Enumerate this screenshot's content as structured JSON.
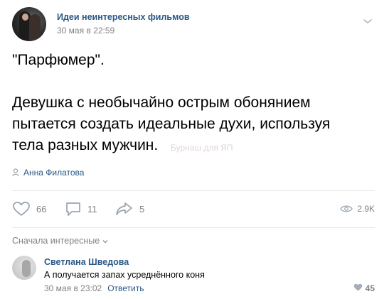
{
  "post": {
    "group_name": "Идеи неинтересных фильмов",
    "date": "30 мая в 22:59",
    "text": "\"Парфюмер\".\n\nДевушка с необычайно острым обонянием\nпытается создать идеальные духи, используя\nтела разных мужчин.",
    "watermark": "Бурнаш для ЯП",
    "author": "Анна Филатова",
    "icons": {
      "menu": "chevron-down-icon",
      "author": "person-icon",
      "like": "heart-icon",
      "comment": "comment-icon",
      "share": "share-icon",
      "views": "eye-icon"
    }
  },
  "actions": {
    "likes": "66",
    "comments": "11",
    "shares": "5",
    "views": "2.9K"
  },
  "comments": {
    "sort_label": "Сначала интересные",
    "items": [
      {
        "name": "Светлана Шведова",
        "text": "А получается запах усреднённого коня",
        "date": "30 мая в 23:02",
        "reply_label": "Ответить",
        "likes": "45"
      }
    ]
  },
  "colors": {
    "link": "#2a5885",
    "muted": "#828282",
    "divider": "#e7e8ec",
    "icon": "#99a2ad"
  }
}
